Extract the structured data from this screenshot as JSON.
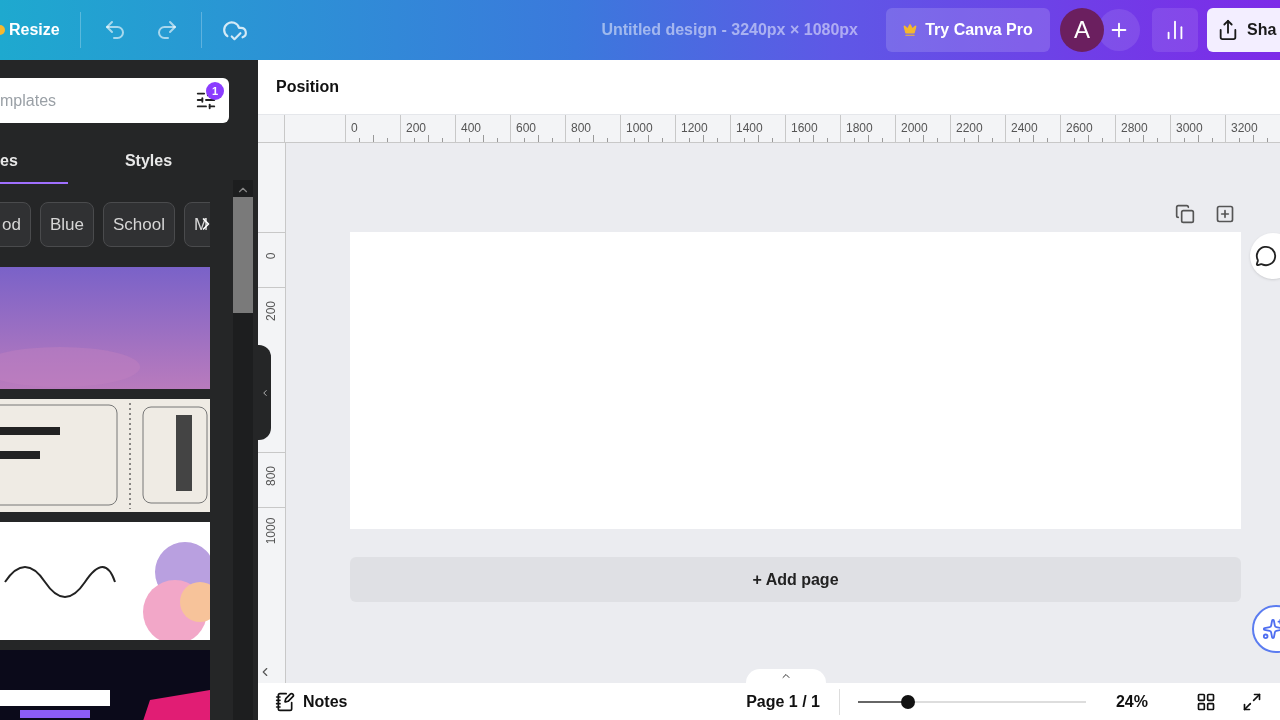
{
  "topbar": {
    "resize": "Resize",
    "title": "Untitled design - 3240px × 1080px",
    "pro_button": "Try Canva Pro",
    "avatar": "A",
    "share": "Sha"
  },
  "panel": {
    "search": {
      "placeholder": "mplates",
      "filter_count": "1"
    },
    "tabs": [
      {
        "label": "es",
        "selected": true
      },
      {
        "label": "Styles",
        "selected": false
      }
    ],
    "chips": [
      "od",
      "Blue",
      "School",
      "M"
    ]
  },
  "toolbar": {
    "title": "Position"
  },
  "ruler": {
    "horizontal": [
      "0",
      "200",
      "400",
      "600",
      "800",
      "1000",
      "1200",
      "1400",
      "1600",
      "1800",
      "2000",
      "2200",
      "2400",
      "2600",
      "2800",
      "3000",
      "3200"
    ],
    "vertical": [
      "0",
      "200",
      "800",
      "1000"
    ]
  },
  "canvas": {
    "add_page": "+ Add page"
  },
  "footer": {
    "notes": "Notes",
    "page": "Page 1 / 1",
    "zoom": {
      "level": 0.22
    },
    "zoom_reading": "24%"
  }
}
